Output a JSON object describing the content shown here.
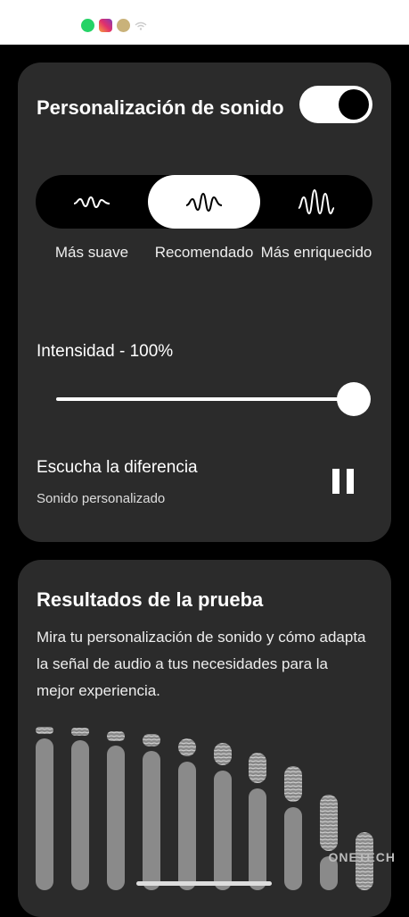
{
  "status_bar": {
    "icons": [
      "whatsapp-icon",
      "instagram-icon",
      "avatar-icon",
      "wifi-icon"
    ]
  },
  "sound_card": {
    "title": "Personalización de sonido",
    "toggle_on": true,
    "presets": [
      {
        "label": "Más suave",
        "icon": "wave-soft-icon",
        "selected": false
      },
      {
        "label": "Recomendado",
        "icon": "wave-medium-icon",
        "selected": true
      },
      {
        "label": "Más enriquecido",
        "icon": "wave-rich-icon",
        "selected": false
      }
    ],
    "intensity_label": "Intensidad - 100%",
    "intensity_value": 1.0,
    "listen_title": "Escucha la diferencia",
    "listen_subtitle": "Sonido personalizado",
    "playback_icon": "pause-icon"
  },
  "results_card": {
    "title": "Resultados de la prueba",
    "description": "Mira tu personalización de sonido y cómo adapta la señal de audio a tus necesidades para la mejor experiencia."
  },
  "watermark": "ONETECH",
  "colors": {
    "background": "#000000",
    "card": "#2b2b2b",
    "accent": "#ffffff",
    "bars": "#8a8a8a"
  }
}
